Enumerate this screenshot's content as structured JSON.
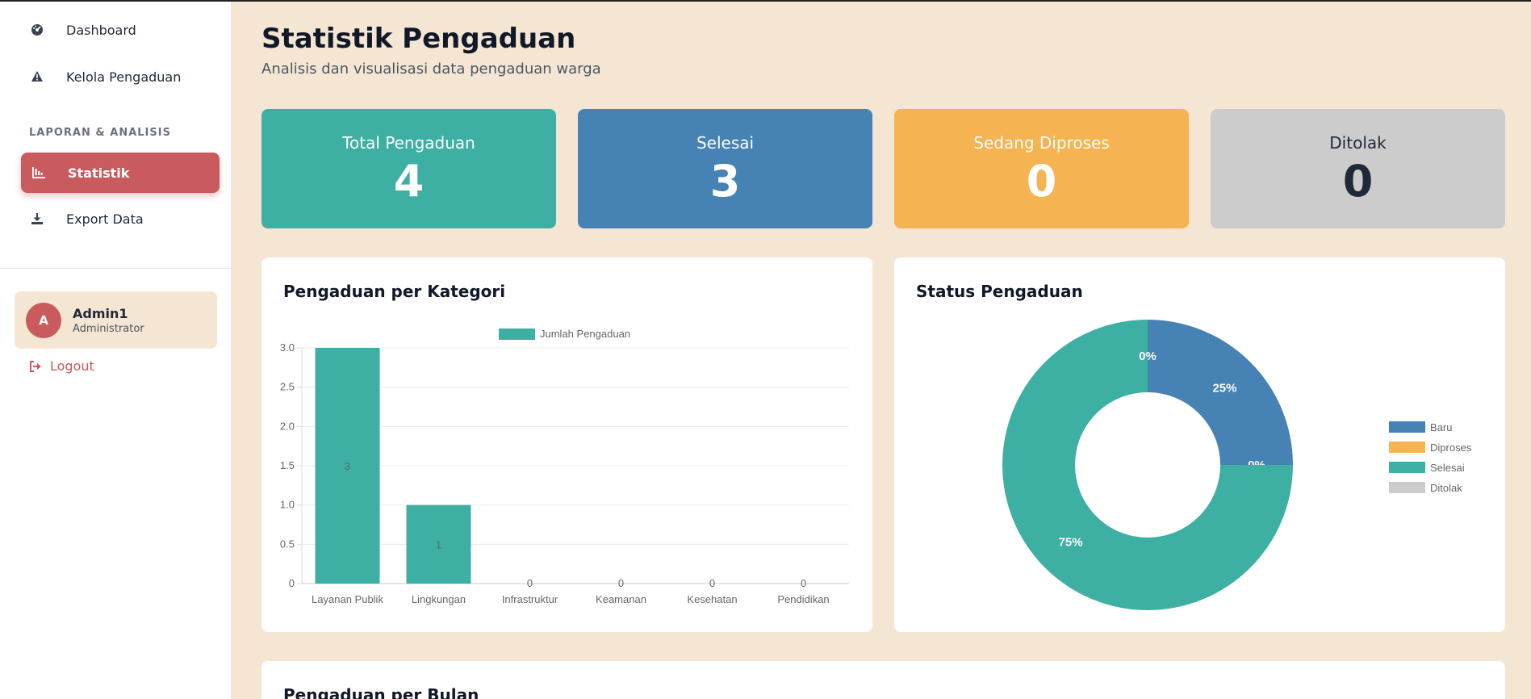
{
  "sidebar": {
    "nav": [
      {
        "label": "Dashboard",
        "icon": "dashboard-icon"
      },
      {
        "label": "Kelola Pengaduan",
        "icon": "warning-icon"
      }
    ],
    "section_label": "LAPORAN & ANALISIS",
    "active_item": {
      "label": "Statistik",
      "icon": "bar-chart-icon"
    },
    "export_item": {
      "label": "Export Data",
      "icon": "download-icon"
    },
    "user": {
      "initial": "A",
      "name": "Admin1",
      "role": "Administrator"
    },
    "logout_label": "Logout"
  },
  "header": {
    "title": "Statistik Pengaduan",
    "subtitle": "Analisis dan visualisasi data pengaduan warga"
  },
  "stats": [
    {
      "label": "Total Pengaduan",
      "value": "4",
      "color": "#3dafa3"
    },
    {
      "label": "Selesai",
      "value": "3",
      "color": "#4682b4"
    },
    {
      "label": "Sedang Diproses",
      "value": "0",
      "color": "#f5b352"
    },
    {
      "label": "Ditolak",
      "value": "0",
      "color": "#cccccc"
    }
  ],
  "panels": {
    "category_title": "Pengaduan per Kategori",
    "status_title": "Status Pengaduan",
    "monthly_title": "Pengaduan per Bulan"
  },
  "chart_data": [
    {
      "type": "bar",
      "title": "Pengaduan per Kategori",
      "categories": [
        "Layanan Publik",
        "Lingkungan",
        "Infrastruktur",
        "Keamanan",
        "Kesehatan",
        "Pendidikan"
      ],
      "series": [
        {
          "name": "Jumlah Pengaduan",
          "values": [
            3,
            1,
            0,
            0,
            0,
            0
          ],
          "color": "#3dafa3"
        }
      ],
      "ylim": [
        0,
        3
      ],
      "yticks": [
        "3.0",
        "2.5",
        "2.0",
        "1.5",
        "1.0",
        "0.5",
        "0"
      ],
      "grid": true,
      "legend": "top"
    },
    {
      "type": "pie",
      "title": "Status Pengaduan",
      "labels": [
        "Baru",
        "Diproses",
        "Selesai",
        "Ditolak"
      ],
      "values": [
        1,
        0,
        3,
        0
      ],
      "percent_labels": [
        "25%",
        "0%",
        "75%",
        "0%"
      ],
      "colors": [
        "#4682b4",
        "#f5b352",
        "#3dafa3",
        "#cccccc"
      ],
      "legend": "right"
    }
  ]
}
